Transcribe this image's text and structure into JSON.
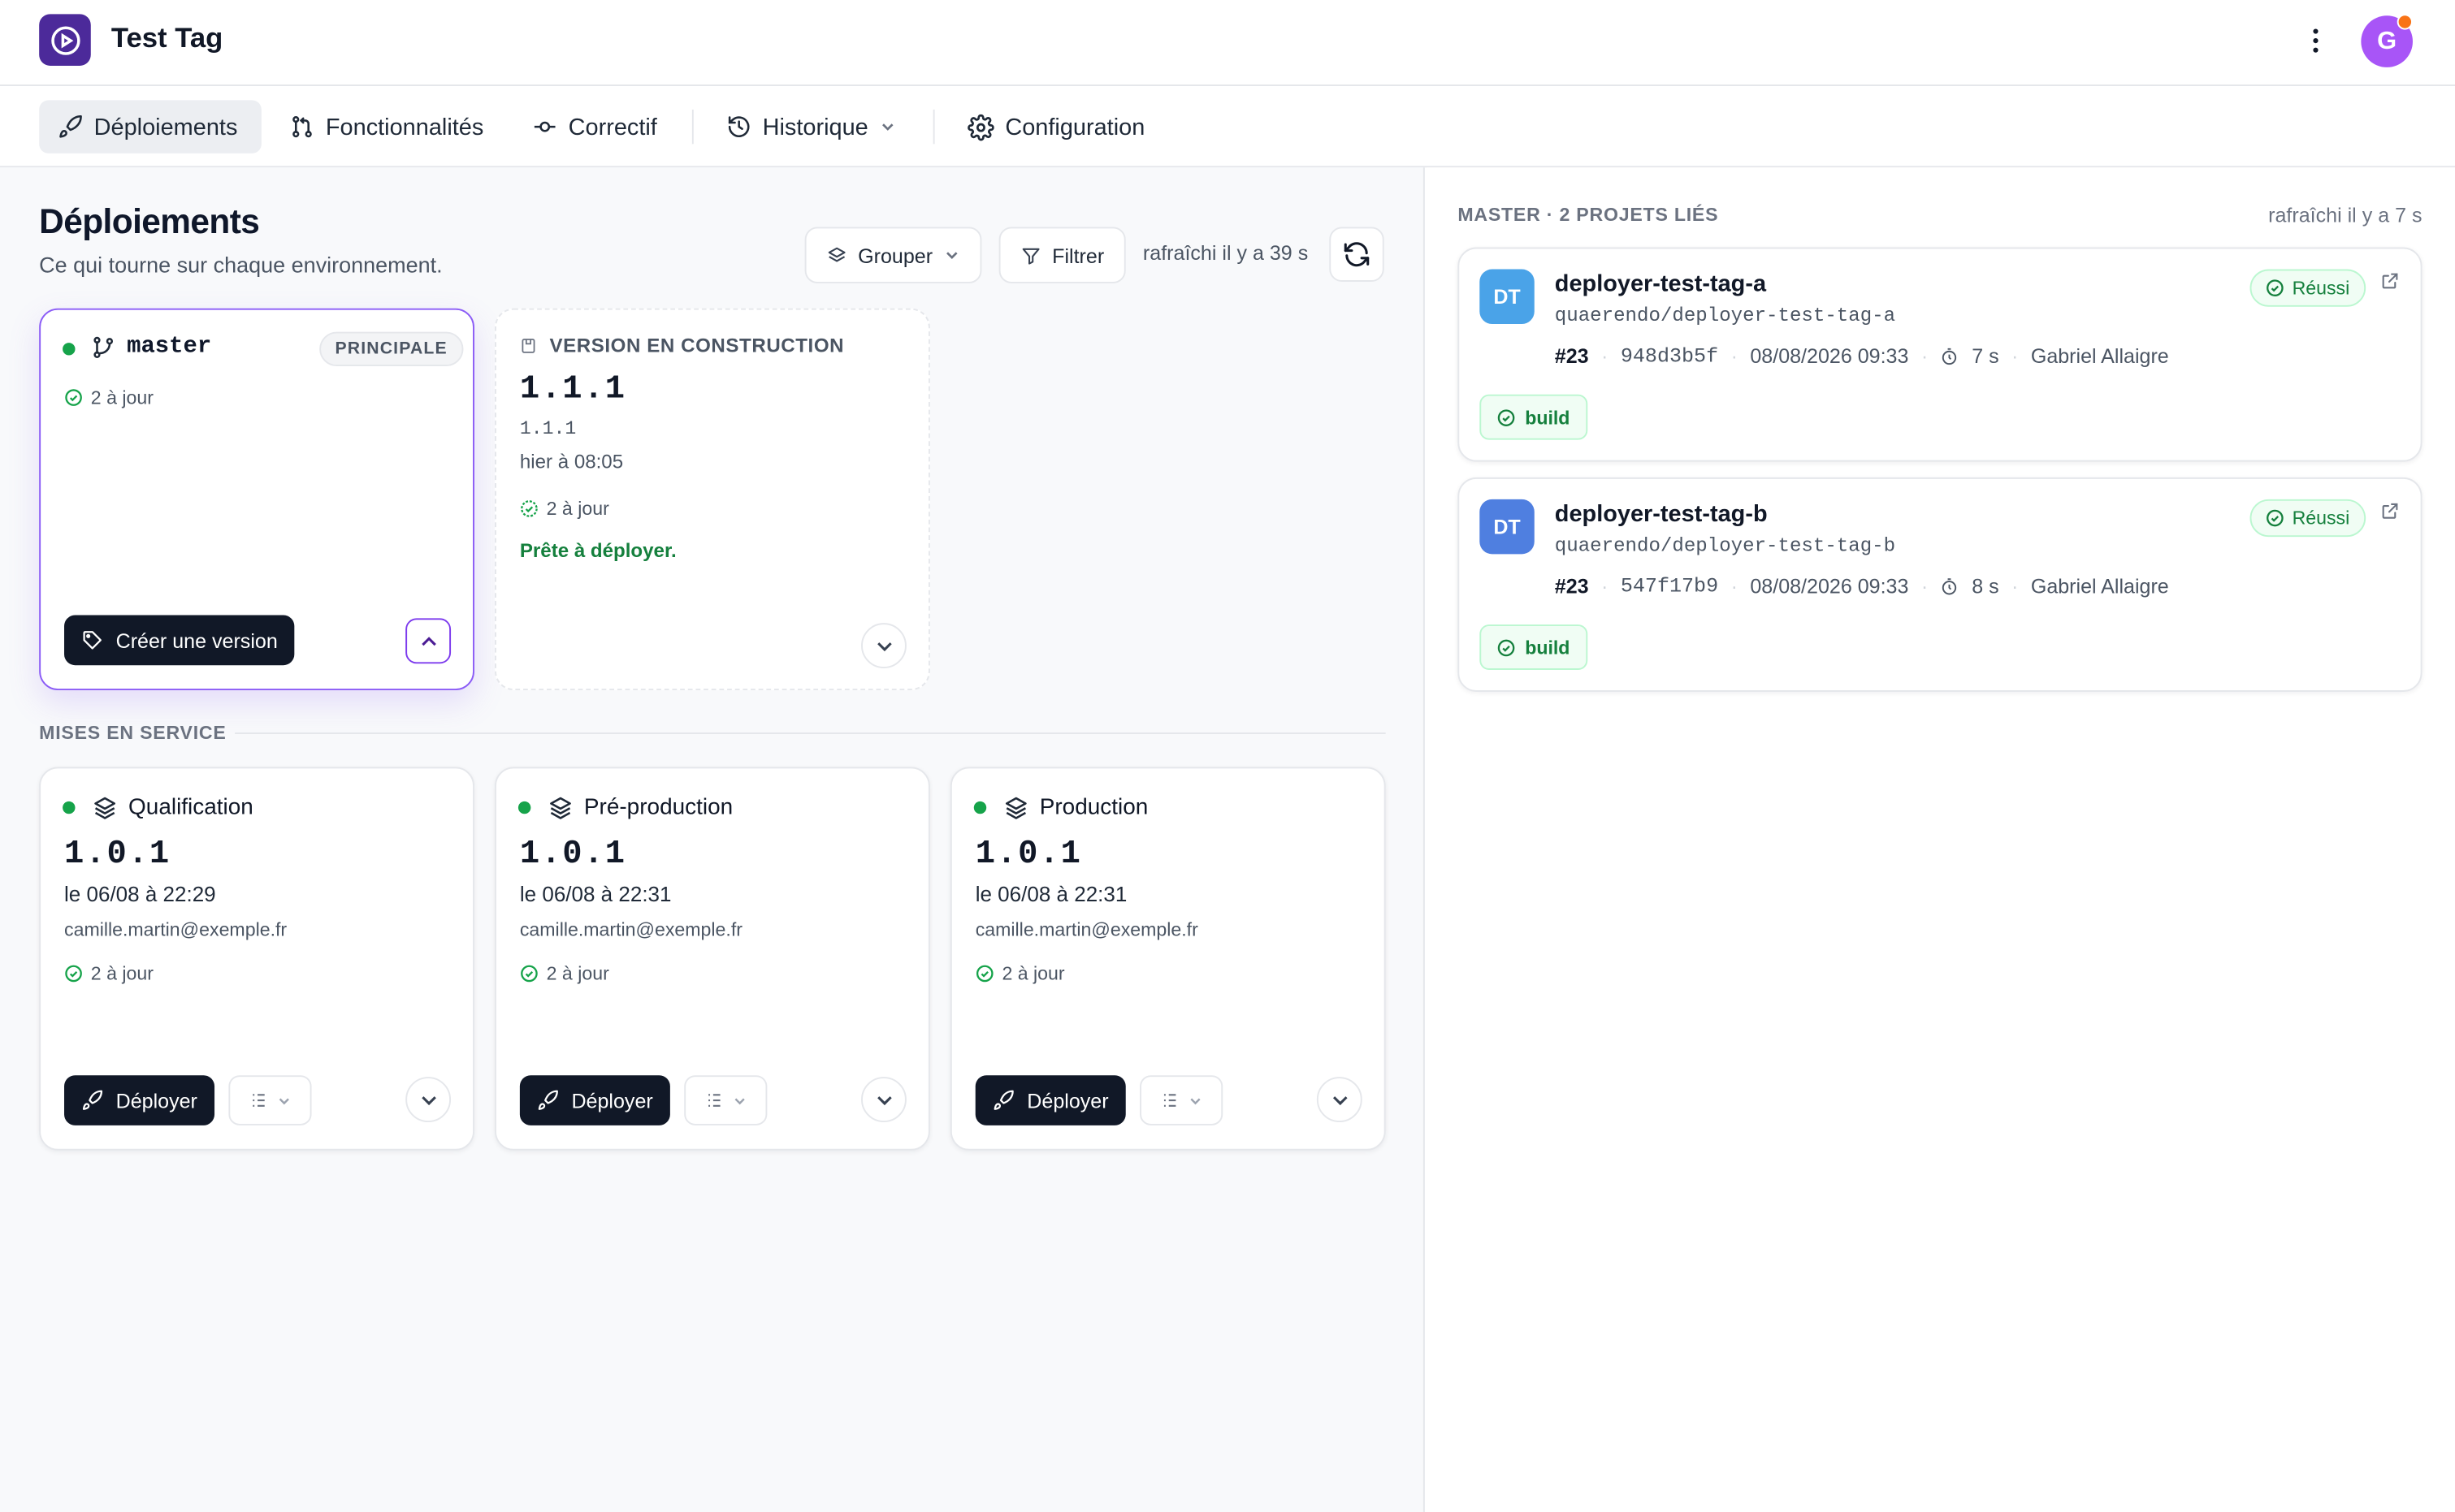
{
  "app": {
    "title": "Test Tag",
    "avatar_initial": "G"
  },
  "nav": {
    "deploiements": "Déploiements",
    "fonctionnalites": "Fonctionnalités",
    "correctif": "Correctif",
    "historique": "Historique",
    "configuration": "Configuration"
  },
  "page": {
    "title": "Déploiements",
    "subtitle": "Ce qui tourne sur chaque environnement.",
    "group_label": "Grouper",
    "filter_label": "Filtrer",
    "refreshed": "rafraîchi il y a 39 s"
  },
  "branch_card": {
    "name": "master",
    "badge": "PRINCIPALE",
    "status": "2 à jour",
    "create_version_label": "Créer une version"
  },
  "build_card": {
    "header": "VERSION EN CONSTRUCTION",
    "version": "1.1.1",
    "version_small": "1.1.1",
    "time": "hier à 08:05",
    "status": "2 à jour",
    "ready": "Prête à déployer."
  },
  "section": {
    "label": "MISES EN SERVICE"
  },
  "environments": [
    {
      "name": "Qualification",
      "version": "1.0.1",
      "date": "le 06/08 à 22:29",
      "email": "camille.martin@exemple.fr",
      "status": "2 à jour",
      "deploy_label": "Déployer"
    },
    {
      "name": "Pré-production",
      "version": "1.0.1",
      "date": "le 06/08 à 22:31",
      "email": "camille.martin@exemple.fr",
      "status": "2 à jour",
      "deploy_label": "Déployer"
    },
    {
      "name": "Production",
      "version": "1.0.1",
      "date": "le 06/08 à 22:31",
      "email": "camille.martin@exemple.fr",
      "status": "2 à jour",
      "deploy_label": "Déployer"
    }
  ],
  "right_panel": {
    "title": "MASTER · 2 PROJETS LIÉS",
    "refreshed": "rafraîchi il y a 7 s",
    "projects": [
      {
        "initials": "DT",
        "color": "#4aa3e8",
        "name": "deployer-test-tag-a",
        "path": "quaerendo/deployer-test-tag-a",
        "run": "#23",
        "commit": "948d3b5f",
        "date": "08/08/2026 09:33",
        "duration": "7 s",
        "author": "Gabriel Allaigre",
        "status": "Réussi",
        "job": "build"
      },
      {
        "initials": "DT",
        "color": "#4f7fe0",
        "name": "deployer-test-tag-b",
        "path": "quaerendo/deployer-test-tag-b",
        "run": "#23",
        "commit": "547f17b9",
        "date": "08/08/2026 09:33",
        "duration": "8 s",
        "author": "Gabriel Allaigre",
        "status": "Réussi",
        "job": "build"
      }
    ]
  },
  "colors": {
    "brand": "#4c2a9a",
    "accent": "#8b5cf6",
    "success": "#16a34a",
    "dark_button": "#111827",
    "avatar": "#a855f7"
  }
}
